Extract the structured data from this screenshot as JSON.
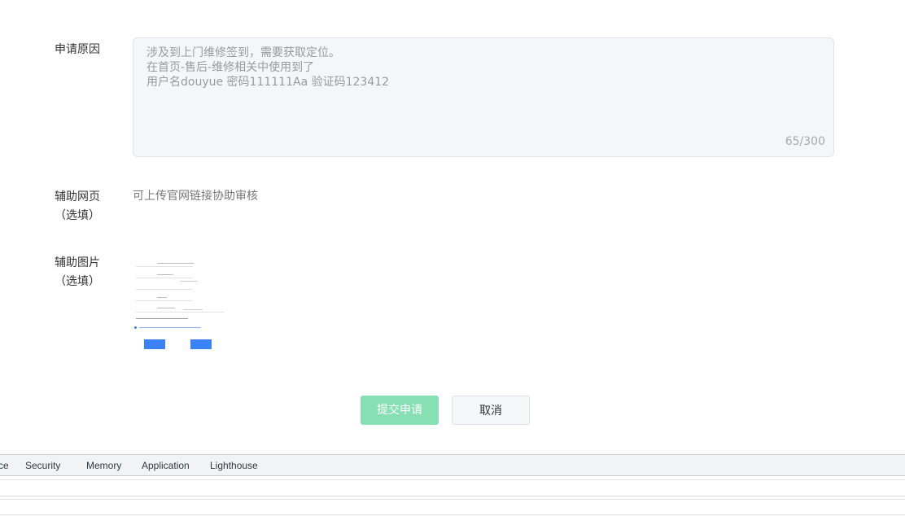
{
  "form": {
    "reason_label": "申请原因",
    "reason_text": "涉及到上门维修签到，需要获取定位。\n在首页-售后-维修相关中使用到了\n用户名douyue 密码111111Aa 验证码123412",
    "reason_count": "65/300",
    "web_label_line1": "辅助网页",
    "web_label_line2": "（选填）",
    "web_hint": "可上传官网链接协助审核",
    "image_label_line1": "辅助图片",
    "image_label_line2": "（选填）"
  },
  "actions": {
    "submit_label": "提交申请",
    "cancel_label": "取消",
    "submit_color": "#86e0b3"
  },
  "devtools": {
    "tabs": [
      "ce",
      "Security",
      "Memory",
      "Application",
      "Lighthouse"
    ]
  }
}
